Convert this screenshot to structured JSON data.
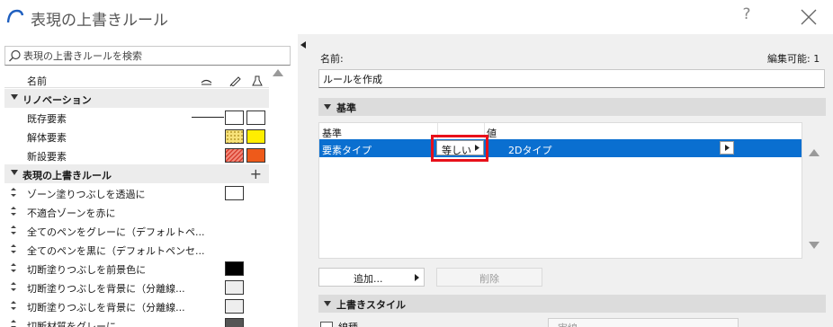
{
  "window": {
    "title": "表現の上書きルール",
    "help_label": "?"
  },
  "left": {
    "search": {
      "placeholder": "表現の上書きルールを検索"
    },
    "header": {
      "name": "名前"
    },
    "groups": [
      {
        "label": "リノベーション",
        "items": [
          {
            "label": "既存要素",
            "fill_color": "#ffffff",
            "pen_color": "#ffffff",
            "line": true
          },
          {
            "label": "解体要素",
            "fill_color": "#f7e27a",
            "pen_color": "#ffee00",
            "pattern": "dots"
          },
          {
            "label": "新設要素",
            "fill_color": "#f28a7a",
            "pen_color": "#ee5a1a",
            "pattern": "hatch"
          }
        ]
      },
      {
        "label": "表現の上書きルール",
        "add_label": "+",
        "items": [
          {
            "label": "ゾーン塗りつぶしを透過に",
            "swatch": "#ffffff"
          },
          {
            "label": "不適合ゾーンを赤に"
          },
          {
            "label": "全てのペンをグレーに（デフォルトペ..."
          },
          {
            "label": "全てのペンを黒に（デフォルトペンセ..."
          },
          {
            "label": "切断塗りつぶしを前景色に",
            "swatch": "#000000"
          },
          {
            "label": "切断塗りつぶしを背景に（分離線...",
            "swatch": "#eeeeee"
          },
          {
            "label": "切断塗りつぶしを背景に（分離線...",
            "swatch": "#eeeeee"
          },
          {
            "label": "切断材質をグレーに",
            "swatch": "#555555"
          }
        ]
      }
    ]
  },
  "right": {
    "name_label": "名前:",
    "editable_label": "編集可能: 1",
    "name_value": "ルールを作成",
    "criteria_section": "基準",
    "criteria_table": {
      "col_criterion": "基準",
      "col_value": "値",
      "row": {
        "criterion": "要素タイプ",
        "operator": "等しい",
        "value": "2Dタイプ"
      }
    },
    "add_button": "追加...",
    "delete_button": "削除",
    "style_section": "上書きスタイル",
    "style_row": {
      "label": "線種",
      "value": "実線"
    }
  },
  "colors": {
    "accent": "#0a6fd0",
    "highlight": "#e8101a"
  }
}
